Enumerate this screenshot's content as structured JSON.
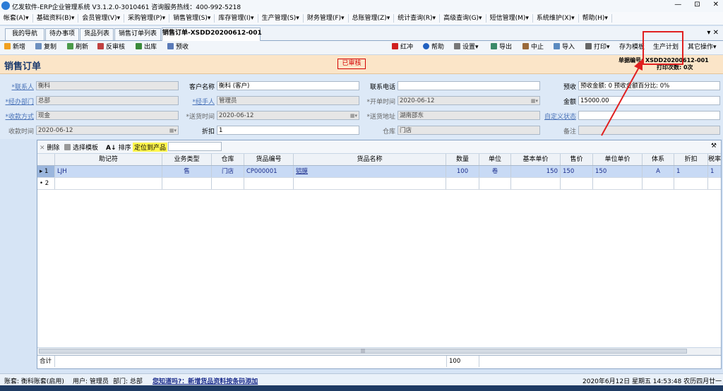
{
  "window": {
    "title": "亿发软件-ERP企业管理系统 V3.1.2.0-3010461 咨询服务热线：400-992-5218",
    "minimize": "—",
    "restore": "⊡",
    "close": "✕"
  },
  "menu": [
    "帐套(A)▾",
    "基础资料(B)▾",
    "会员管理(V)▾",
    "采购管理(P)▾",
    "销售管理(S)▾",
    "库存管理(I)▾",
    "生产管理(S)▾",
    "财务管理(F)▾",
    "总账管理(Z)▾",
    "统计查询(R)▾",
    "高级查询(G)▾",
    "短信管理(M)▾",
    "系统维护(X)▾",
    "帮助(H)▾"
  ],
  "tabs": [
    "我的导航",
    "待办事项",
    "货品列表",
    "销售订单列表",
    "销售订单-XSDD20200612-001"
  ],
  "tabs_close": "▾ ✕",
  "toolbar": {
    "new": "新增",
    "copy": "复制",
    "refresh": "刷新",
    "unaudit": "反审核",
    "outstock": "出库",
    "preview": "预收",
    "redflush": "红冲",
    "help": "帮助",
    "settings": "设置▾",
    "export": "导出",
    "stop": "中止",
    "import": "导入",
    "print": "打印▾",
    "save_template": "存为模板",
    "production_plan": "生产计划",
    "other_ops": "其它操作▾"
  },
  "header": {
    "title": "销售订单",
    "stamp": "已审核",
    "order_no": "单据编号: XSDD20200612-001",
    "print_count": "打印次数: 0次"
  },
  "form": {
    "contact_label": "*联系人",
    "contact_value": "衡科",
    "customer_label": "客户名称",
    "customer_value": "衡科 (客户)",
    "phone_label": "联系电话",
    "phone_value": "",
    "prepay_label": "预收",
    "prepay_value": "预收金额: 0  预收金额百分比: 0%",
    "dept_label": "*经办部门",
    "dept_value": "总部",
    "handler_label": "*经手人",
    "handler_value": "管理员",
    "open_label": "*开单时间",
    "open_value": "2020-06-12",
    "amount_label": "金额",
    "amount_value": "15000.00",
    "payment_label": "*收款方式",
    "payment_value": "现金",
    "delivery_label": "*送货时间",
    "delivery_value": "2020-06-12",
    "address_label": "*送货地址",
    "address_value": "湖南邵东",
    "custom_label": "自定义状态",
    "custom_value": "",
    "collect_label": "收款时间",
    "collect_value": "2020-06-12",
    "discount_label": "折扣",
    "discount_value": "1",
    "warehouse_label": "仓库",
    "warehouse_value": "门店",
    "remark_label": "备注",
    "remark_value": ""
  },
  "grid": {
    "toolbar": {
      "delete": "删除",
      "choose_template": "选择模板",
      "sort": "排序",
      "locate": "定位到产品"
    },
    "columns": [
      "助记符",
      "业务类型",
      "仓库",
      "货品编号",
      "货品名称",
      "数量",
      "单位",
      "基本单价",
      "售价",
      "单位单价",
      "体系",
      "折扣",
      "税率"
    ],
    "rows": [
      {
        "marker": "▸ 1",
        "code": "LJH",
        "biz": "售",
        "wh": "门店",
        "pno": "CP000001",
        "pname": "铝膜",
        "qty": "100",
        "unit": "卷",
        "base": "150",
        "price": "150",
        "uprice": "150",
        "sys": "A",
        "disc": "1",
        "tax": "1"
      },
      {
        "marker": "• 2",
        "code": "",
        "biz": "",
        "wh": "",
        "pno": "",
        "pname": "",
        "qty": "",
        "unit": "",
        "base": "",
        "price": "",
        "uprice": "",
        "sys": "",
        "disc": "",
        "tax": ""
      }
    ],
    "sum_label": "合计",
    "sum_qty": "100",
    "scroll_grip": "|||"
  },
  "status": {
    "account": "账套: 衡科账套(启用)",
    "user": "用户: 管理员",
    "dept": "部门: 总部",
    "tip": "您知道吗?：新增货品资料按条码添加",
    "datetime": "2020年6月12日 星期五 14:53:48 农历四月廿一"
  },
  "colors": {
    "accent": "#1a3a6e",
    "stamp": "#d40000",
    "header_bg": "#fbe5c8",
    "annotation": "#e02020"
  }
}
